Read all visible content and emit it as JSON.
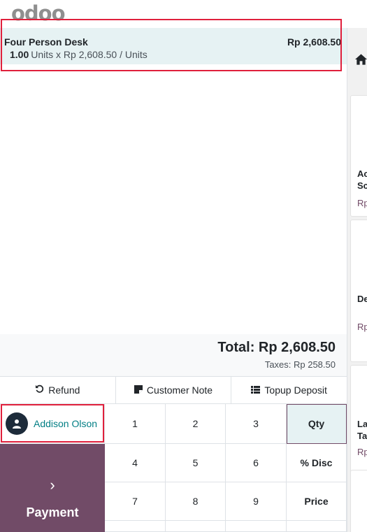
{
  "header": {
    "logo_text": "odoo"
  },
  "order": {
    "lines": [
      {
        "name": "Four Person Desk",
        "price": "Rp 2,608.50",
        "qty": "1.00",
        "detail": "Units x Rp 2,608.50 / Units"
      }
    ],
    "total": "Total: Rp 2,608.50",
    "taxes": "Taxes: Rp 258.50"
  },
  "controls": {
    "refund": "Refund",
    "customer_note": "Customer Note",
    "topup_deposit": "Topup Deposit"
  },
  "customer": {
    "name": "Addison Olson"
  },
  "payment": {
    "label": "Payment",
    "chevron": "›"
  },
  "numpad": {
    "k1": "1",
    "k2": "2",
    "k3": "3",
    "qty": "Qty",
    "k4": "4",
    "k5": "5",
    "k6": "6",
    "disc": "% Disc",
    "k7": "7",
    "k8": "8",
    "k9": "9",
    "price": "Price"
  },
  "products": [
    {
      "name_line1": "Ac",
      "name_line2": "Sc",
      "price": "Rp"
    },
    {
      "name_line1": "De",
      "name_line2": "",
      "price": "Rp"
    },
    {
      "name_line1": "La",
      "name_line2": "Ta",
      "price": "Rp"
    }
  ],
  "colors": {
    "brand": "#714B67",
    "accent": "#017e84",
    "highlight": "#e0203c",
    "selected_bg": "#e6f2f3"
  }
}
